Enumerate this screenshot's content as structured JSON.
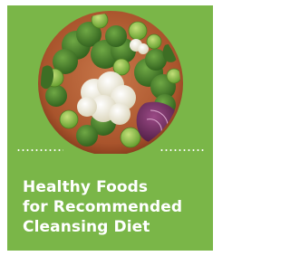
{
  "card": {
    "background": "#7ab648",
    "title_lines": [
      "Healthy Foods",
      "for Recommended",
      "Cleansing Diet"
    ]
  },
  "image": {
    "subject": "vegetables-bowl",
    "colors": {
      "bowl": "#b8653a",
      "broccoli": "#4f8a2e",
      "cauliflower": "#f2eedc",
      "cabbage": "#6b2a5a",
      "sprouts": "#8cbf3a"
    }
  }
}
